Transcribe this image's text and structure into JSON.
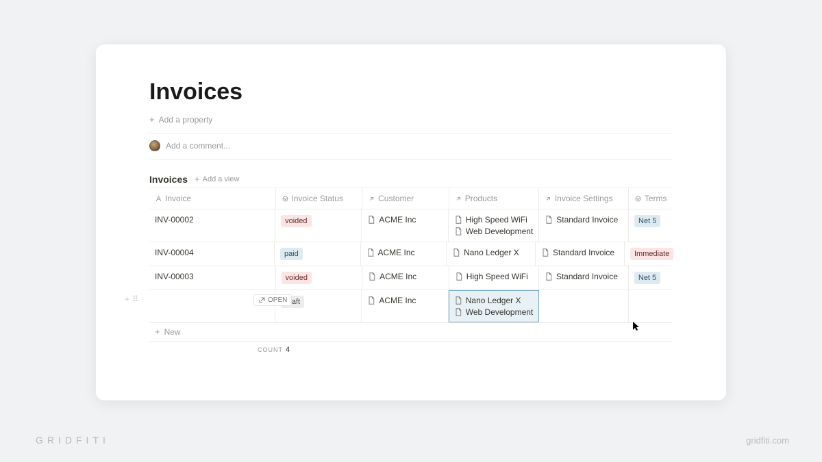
{
  "page": {
    "title": "Invoices",
    "add_property": "Add a property",
    "add_comment": "Add a comment..."
  },
  "view": {
    "title": "Invoices",
    "add_view": "Add a view",
    "new_row": "New",
    "open_btn": "OPEN",
    "count_label": "COUNT",
    "count_value": "4"
  },
  "columns": {
    "invoice": "Invoice",
    "status": "Invoice Status",
    "customer": "Customer",
    "products": "Products",
    "settings": "Invoice Settings",
    "terms": "Terms"
  },
  "status_tags": {
    "voided": "voided",
    "paid": "paid",
    "draft": "draft"
  },
  "terms_tags": {
    "net5": "Net 5",
    "immediate": "Immediate"
  },
  "rows": [
    {
      "invoice": "INV-00002",
      "status": "voided",
      "customer": "ACME Inc",
      "products": [
        "High Speed WiFi",
        "Web Development"
      ],
      "settings": "Standard Invoice",
      "terms": "net5"
    },
    {
      "invoice": "INV-00004",
      "status": "paid",
      "customer": "ACME Inc",
      "products": [
        "Nano Ledger X"
      ],
      "settings": "Standard Invoice",
      "terms": "immediate"
    },
    {
      "invoice": "INV-00003",
      "status": "voided",
      "customer": "ACME Inc",
      "products": [
        "High Speed WiFi"
      ],
      "settings": "Standard Invoice",
      "terms": "net5"
    },
    {
      "invoice": "",
      "status": "draft",
      "customer": "ACME Inc",
      "products": [
        "Nano Ledger X",
        "Web Development"
      ],
      "settings": "",
      "terms": "",
      "editing": true
    }
  ],
  "watermark": {
    "left": "GRIDFITI",
    "right": "gridfiti.com"
  }
}
